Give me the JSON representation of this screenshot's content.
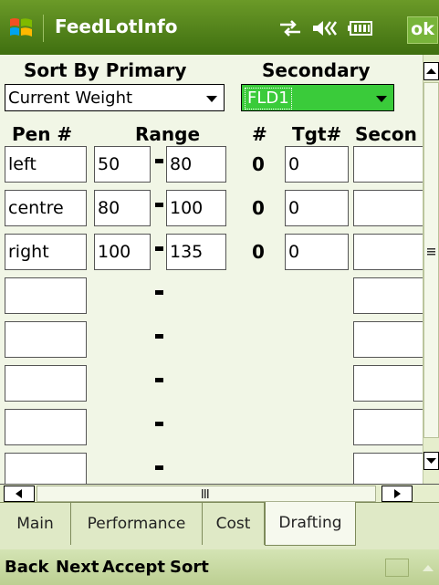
{
  "window": {
    "title": "FeedLotInfo",
    "ok_label": "ok"
  },
  "sort": {
    "primary_label": "Sort By Primary",
    "secondary_label": "Secondary",
    "primary_value": "Current Weight",
    "secondary_value": "FLD1"
  },
  "columns": {
    "pen": "Pen #",
    "range": "Range",
    "count": "#",
    "target": "Tgt#",
    "secondary": "Secon"
  },
  "rows": [
    {
      "pen": "left",
      "min": "50",
      "max": "80",
      "count": "0",
      "target": "0"
    },
    {
      "pen": "centre",
      "min": "80",
      "max": "100",
      "count": "0",
      "target": "0"
    },
    {
      "pen": "right",
      "min": "100",
      "max": "135",
      "count": "0",
      "target": "0"
    }
  ],
  "tabs": [
    "Main",
    "Performance",
    "Cost",
    "Drafting"
  ],
  "active_tab": "Drafting",
  "menu": [
    "Back",
    "Next",
    "Accept",
    "Sort"
  ],
  "colors": {
    "titlebar": "#4f7f1c",
    "secondary_dropdown": "#3acb3a",
    "background": "#f1f6e6"
  }
}
